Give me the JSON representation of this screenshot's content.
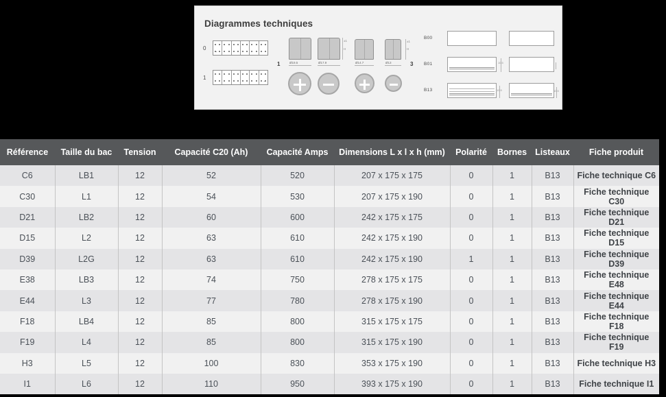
{
  "diagram": {
    "title": "Diagrammes techniques",
    "polarity": {
      "labels": [
        "0",
        "1"
      ],
      "cells": 6
    },
    "terminals": {
      "indexes": [
        "1",
        "3"
      ],
      "diameters": [
        "Ø19.5",
        "Ø17.9",
        "Ø14.7",
        "Ø13"
      ]
    },
    "listeaux": {
      "labels": [
        "B00",
        "B01",
        "B13"
      ]
    }
  },
  "table": {
    "columns": [
      "Référence",
      "Taille du bac",
      "Tension",
      "Capacité C20 (Ah)",
      "Capacité Amps",
      "Dimensions L x l x h (mm)",
      "Polarité",
      "Bornes",
      "Listeaux",
      "Fiche produit"
    ],
    "rows": [
      [
        "C6",
        "LB1",
        "12",
        "52",
        "520",
        "207 x 175 x 175",
        "0",
        "1",
        "B13",
        "Fiche technique C6"
      ],
      [
        "C30",
        "L1",
        "12",
        "54",
        "530",
        "207 x 175 x 190",
        "0",
        "1",
        "B13",
        "Fiche technique C30"
      ],
      [
        "D21",
        "LB2",
        "12",
        "60",
        "600",
        "242 x 175 x 175",
        "0",
        "1",
        "B13",
        "Fiche technique D21"
      ],
      [
        "D15",
        "L2",
        "12",
        "63",
        "610",
        "242 x 175 x 190",
        "0",
        "1",
        "B13",
        "Fiche technique D15"
      ],
      [
        "D39",
        "L2G",
        "12",
        "63",
        "610",
        "242 x 175 x 190",
        "1",
        "1",
        "B13",
        "Fiche technique D39"
      ],
      [
        "E38",
        "LB3",
        "12",
        "74",
        "750",
        "278 x 175 x 175",
        "0",
        "1",
        "B13",
        "Fiche technique E48"
      ],
      [
        "E44",
        "L3",
        "12",
        "77",
        "780",
        "278 x 175 x 190",
        "0",
        "1",
        "B13",
        "Fiche technique E44"
      ],
      [
        "F18",
        "LB4",
        "12",
        "85",
        "800",
        "315 x 175 x 175",
        "0",
        "1",
        "B13",
        "Fiche technique F18"
      ],
      [
        "F19",
        "L4",
        "12",
        "85",
        "800",
        "315 x 175 x 190",
        "0",
        "1",
        "B13",
        "Fiche technique F19"
      ],
      [
        "H3",
        "L5",
        "12",
        "100",
        "830",
        "353 x 175 x 190",
        "0",
        "1",
        "B13",
        "Fiche technique H3"
      ],
      [
        "I1",
        "L6",
        "12",
        "110",
        "950",
        "393 x 175 x 190",
        "0",
        "1",
        "B13",
        "Fiche technique I1"
      ]
    ]
  },
  "colors": {
    "header_bg": "#56585a",
    "row_odd": "#e4e4e6",
    "row_even": "#f1f1f1",
    "page_bg": "#000000",
    "panel_bg": "#f2f2f2"
  }
}
